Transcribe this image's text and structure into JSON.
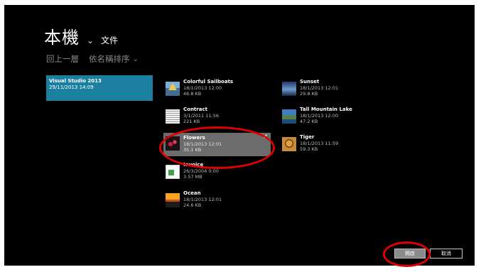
{
  "header": {
    "title": "本機",
    "title_chevron": "⌄",
    "sublocation": "文件"
  },
  "nav": {
    "up_label": "回上一層",
    "sort_label": "依名稱排序",
    "sort_chevron": "⌄"
  },
  "folders": [
    {
      "name": "Visual Studio 2013",
      "date": "29/11/2013 14:09"
    }
  ],
  "files": [
    {
      "name": "Colorful Sailboats",
      "date": "18/1/2013 12:00",
      "size": "46.8 KB",
      "icon": "sailboats-thumbnail"
    },
    {
      "name": "Contract",
      "date": "3/1/2011 11:56",
      "size": "221 KB",
      "icon": "document-thumbnail"
    },
    {
      "name": "Flowers",
      "date": "18/1/2013 12:01",
      "size": "35.1 KB",
      "icon": "flowers-thumbnail",
      "selected": true
    },
    {
      "name": "Invoice",
      "date": "26/3/2004 0:00",
      "size": "3.57 MB",
      "icon": "spreadsheet-thumbnail"
    },
    {
      "name": "Ocean",
      "date": "18/1/2013 12:01",
      "size": "24.6 KB",
      "icon": "ocean-thumbnail"
    },
    {
      "name": "Sunset",
      "date": "18/1/2013 12:01",
      "size": "29.8 KB",
      "icon": "sunset-thumbnail"
    },
    {
      "name": "Tall Mountain Lake",
      "date": "18/1/2013 12:00",
      "size": "47.2 KB",
      "icon": "lake-thumbnail"
    },
    {
      "name": "Tiger",
      "date": "18/1/2013 11:59",
      "size": "59.3 KB",
      "icon": "tiger-thumbnail"
    }
  ],
  "selection_check": "✔",
  "buttons": {
    "open_label": "開啟",
    "cancel_label": "取消"
  },
  "colors": {
    "background": "#000000",
    "folder_tile": "#1b7fa0",
    "selected_tile": "#6c6c6c",
    "annotation": "#e00000"
  }
}
